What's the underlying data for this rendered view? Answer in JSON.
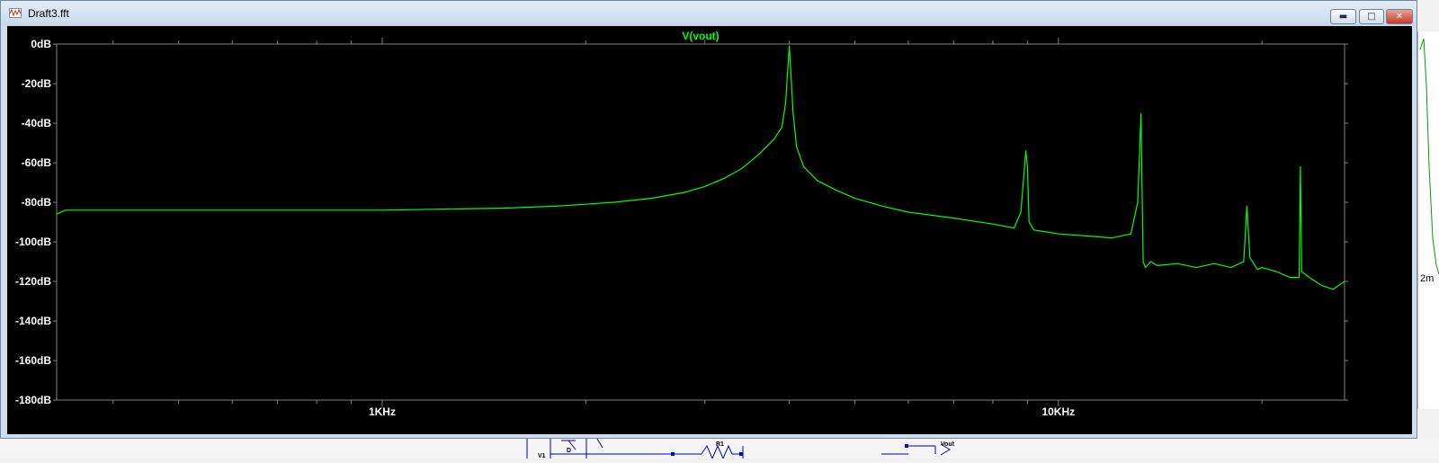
{
  "window": {
    "title": "Draft3.fft",
    "minimize_glyph": "▬",
    "maximize_glyph": "□",
    "close_glyph": "✕"
  },
  "schematic": {
    "labels": [
      "V1",
      "D",
      "R1",
      "Vout"
    ]
  },
  "side_window": {
    "fragment": "2m"
  },
  "colors": {
    "trace": "#00ff00",
    "axes": "#808080",
    "labels": "#ffffff",
    "background": "#000000"
  },
  "chart_data": {
    "type": "line",
    "title": "V(vout)",
    "xlabel": "",
    "ylabel": "",
    "x_scale": "log",
    "xlim": [
      330,
      26500
    ],
    "ylim": [
      -180,
      0
    ],
    "grid": false,
    "x_ticks": [
      {
        "value": 1000,
        "label": "1KHz"
      },
      {
        "value": 10000,
        "label": "10KHz"
      }
    ],
    "y_ticks": [
      {
        "value": 0,
        "label": "0dB"
      },
      {
        "value": -20,
        "label": "-20dB"
      },
      {
        "value": -40,
        "label": "-40dB"
      },
      {
        "value": -60,
        "label": "-60dB"
      },
      {
        "value": -80,
        "label": "-80dB"
      },
      {
        "value": -100,
        "label": "-100dB"
      },
      {
        "value": -120,
        "label": "-120dB"
      },
      {
        "value": -140,
        "label": "-140dB"
      },
      {
        "value": -160,
        "label": "-160dB"
      },
      {
        "value": -180,
        "label": "-180dB"
      }
    ],
    "series": [
      {
        "name": "V(vout)",
        "color": "#00ff00",
        "x": [
          330,
          340,
          400,
          500,
          600,
          800,
          1000,
          1200,
          1500,
          1800,
          2000,
          2200,
          2500,
          2800,
          3000,
          3200,
          3400,
          3600,
          3800,
          3900,
          3950,
          3980,
          4000,
          4020,
          4050,
          4100,
          4200,
          4400,
          4700,
          5000,
          5500,
          6000,
          7000,
          8000,
          8600,
          8800,
          8950,
          9000,
          9050,
          9200,
          9600,
          10000,
          11000,
          12000,
          12800,
          13100,
          13250,
          13300,
          13350,
          13450,
          13700,
          14000,
          15000,
          16000,
          17000,
          18000,
          18800,
          19000,
          19200,
          19700,
          20000,
          21000,
          22000,
          22700,
          22800,
          22900,
          23500,
          24500,
          25500,
          26500
        ],
        "y": [
          -86,
          -84,
          -84,
          -84,
          -84,
          -84,
          -84,
          -83.5,
          -83,
          -82,
          -81,
          -80,
          -78,
          -75,
          -72,
          -68,
          -63,
          -56,
          -48,
          -42,
          -30,
          -12,
          -1,
          -14,
          -34,
          -52,
          -62,
          -69,
          -74,
          -78,
          -82,
          -85,
          -88,
          -91,
          -93,
          -85,
          -54,
          -62,
          -90,
          -94,
          -95,
          -96,
          -97,
          -98,
          -96,
          -80,
          -35,
          -75,
          -110,
          -113,
          -110,
          -112,
          -111,
          -113,
          -111,
          -113,
          -110,
          -82,
          -108,
          -114,
          -113,
          -115,
          -118,
          -118,
          -62,
          -115,
          -118,
          -122,
          -124,
          -120
        ]
      }
    ]
  }
}
